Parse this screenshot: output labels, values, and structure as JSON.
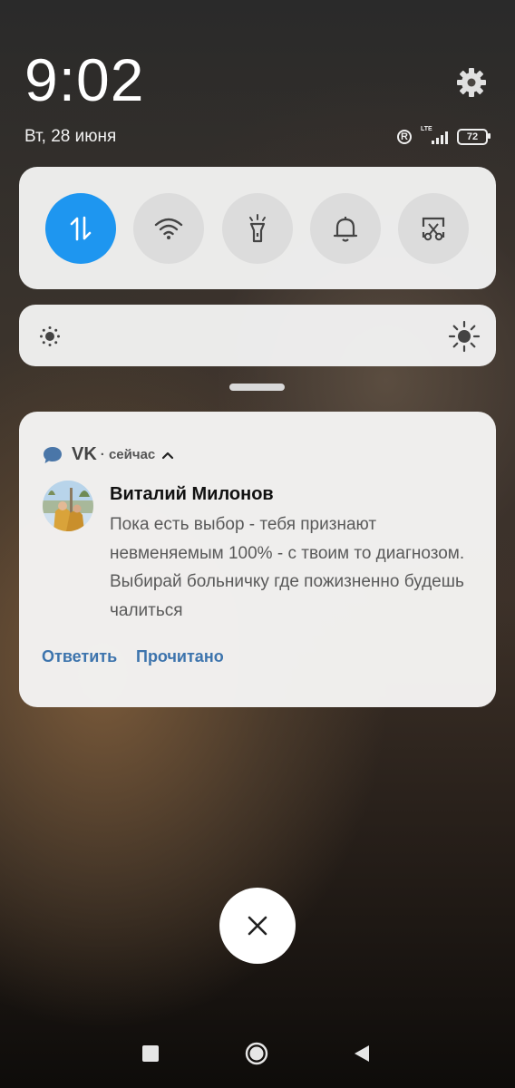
{
  "status": {
    "time": "9:02",
    "date": "Вт, 28 июня",
    "roaming_badge": "R",
    "network_label": "LTE",
    "battery": "72",
    "icons": [
      "gear-icon",
      "roaming-icon",
      "signal-icon",
      "battery-icon"
    ]
  },
  "quick_toggles": [
    {
      "name": "mobile-data",
      "icon": "data-transfer-icon",
      "active": true
    },
    {
      "name": "wifi",
      "icon": "wifi-icon",
      "active": false
    },
    {
      "name": "flashlight",
      "icon": "flashlight-icon",
      "active": false
    },
    {
      "name": "sound",
      "icon": "bell-icon",
      "active": false
    },
    {
      "name": "screenshot",
      "icon": "screenshot-scissors-icon",
      "active": false
    }
  ],
  "brightness": {
    "icons": [
      "brightness-low-icon",
      "brightness-high-icon"
    ]
  },
  "notification": {
    "app_name": "VK",
    "time": "· сейчас",
    "sender": "Виталий Милонов",
    "message": "Пока есть выбор - тебя признают невменяемым 100% - с твоим то диагнозом. Выбирай больничку где пожизненно будешь чалиться",
    "actions": {
      "reply": "Ответить",
      "read": "Прочитано"
    }
  },
  "colors": {
    "accent": "#1e96f0",
    "action_text": "#3d74ad",
    "vk_icon": "#4a76a8"
  }
}
